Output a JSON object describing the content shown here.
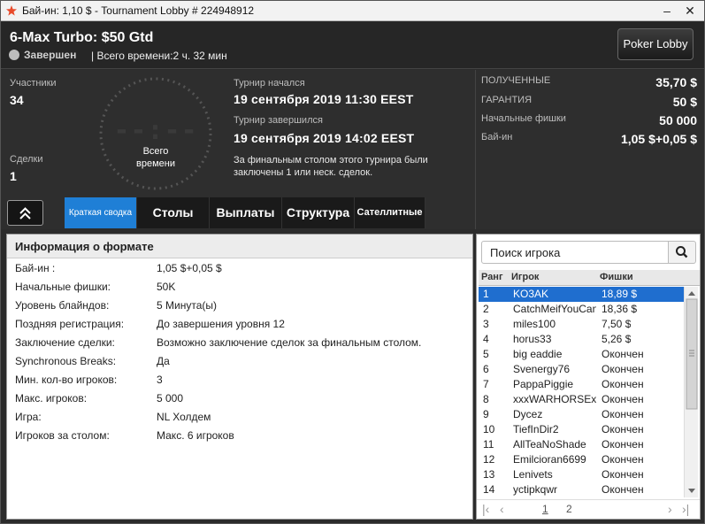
{
  "window": {
    "title": "Бай-ин: 1,10 $ - Tournament Lobby # 224948912",
    "brand_color": "#e84a2a"
  },
  "header": {
    "tournament_name": "6-Max Turbo: $50 Gtd",
    "status": "Завершен",
    "total_time": "| Всего времени:2 ч. 32 мин",
    "lobby_button": "Poker Lobby"
  },
  "stats": {
    "participants_label": "Участники",
    "participants": "34",
    "deals_label": "Сделки",
    "deals": "1"
  },
  "clock": {
    "digits": "--:--",
    "label_line1": "Всего",
    "label_line2": "времени"
  },
  "schedule": {
    "started_label": "Турнир начался",
    "started": "19 сентября 2019  11:30 EEST",
    "ended_label": "Турнир завершился",
    "ended": "19 сентября 2019  14:02 EEST",
    "note": "За финальным столом этого турнира были заключены 1 или неск. сделок."
  },
  "prize": {
    "received_label": "ПОЛУЧЕННЫЕ",
    "received": "35,70 $",
    "guarantee_label": "ГАРАНТИЯ",
    "guarantee": "50 $",
    "chips_label": "Начальные фишки",
    "chips": "50 000",
    "buyin_label": "Бай-ин",
    "buyin": "1,05 $+0,05 $"
  },
  "tabs": [
    {
      "label": "Краткая сводка",
      "active": true
    },
    {
      "label": "Столы"
    },
    {
      "label": "Выплаты"
    },
    {
      "label": "Структура"
    },
    {
      "label": "Сателлитные"
    }
  ],
  "format": {
    "title": "Информация о формате",
    "rows": [
      {
        "k": "Бай-ин :",
        "v": "1,05 $+0,05 $"
      },
      {
        "k": "Начальные фишки:",
        "v": "50K"
      },
      {
        "k": "Уровень блайндов:",
        "v": "5 Минута(ы)"
      },
      {
        "k": "Поздняя регистрация:",
        "v": "До завершения уровня 12"
      },
      {
        "k": "Заключение сделки:",
        "v": "Возможно заключение сделок за финальным столом."
      },
      {
        "k": "Synchronous Breaks:",
        "v": "Да"
      },
      {
        "k": "Мин. кол-во игроков:",
        "v": "3"
      },
      {
        "k": "Макс. игроков:",
        "v": "5 000"
      },
      {
        "k": "Игра:",
        "v": "NL Холдем"
      },
      {
        "k": "Игроков за столом:",
        "v": "Макс. 6 игроков"
      }
    ]
  },
  "players": {
    "search_placeholder": "Поиск игрока",
    "col_rank": "Ранг",
    "col_player": "Игрок",
    "col_chips": "Фишки",
    "selected_color": "#1f6ecf",
    "rows": [
      {
        "rank": "1",
        "name": "KO3AK",
        "chips": "18,89 $"
      },
      {
        "rank": "2",
        "name": "CatchMeifYouCan",
        "chips": "18,36 $"
      },
      {
        "rank": "3",
        "name": "miles100",
        "chips": "7,50 $"
      },
      {
        "rank": "4",
        "name": "horus33",
        "chips": "5,26 $"
      },
      {
        "rank": "5",
        "name": "big eaddie",
        "chips": "Окончен"
      },
      {
        "rank": "6",
        "name": "Svenergy76",
        "chips": "Окончен"
      },
      {
        "rank": "7",
        "name": "PappaPiggie",
        "chips": "Окончен"
      },
      {
        "rank": "8",
        "name": "xxxWARHORSEx...",
        "chips": "Окончен"
      },
      {
        "rank": "9",
        "name": "Dycez",
        "chips": "Окончен"
      },
      {
        "rank": "10",
        "name": "TiefInDir2",
        "chips": "Окончен"
      },
      {
        "rank": "11",
        "name": "AllTeaNoShade",
        "chips": "Окончен"
      },
      {
        "rank": "12",
        "name": "Emilcioran6699",
        "chips": "Окончен"
      },
      {
        "rank": "13",
        "name": "Lenivets",
        "chips": "Окончен"
      },
      {
        "rank": "14",
        "name": "yctipkqwr",
        "chips": "Окончен"
      }
    ],
    "pages": [
      "1",
      "2"
    ]
  }
}
